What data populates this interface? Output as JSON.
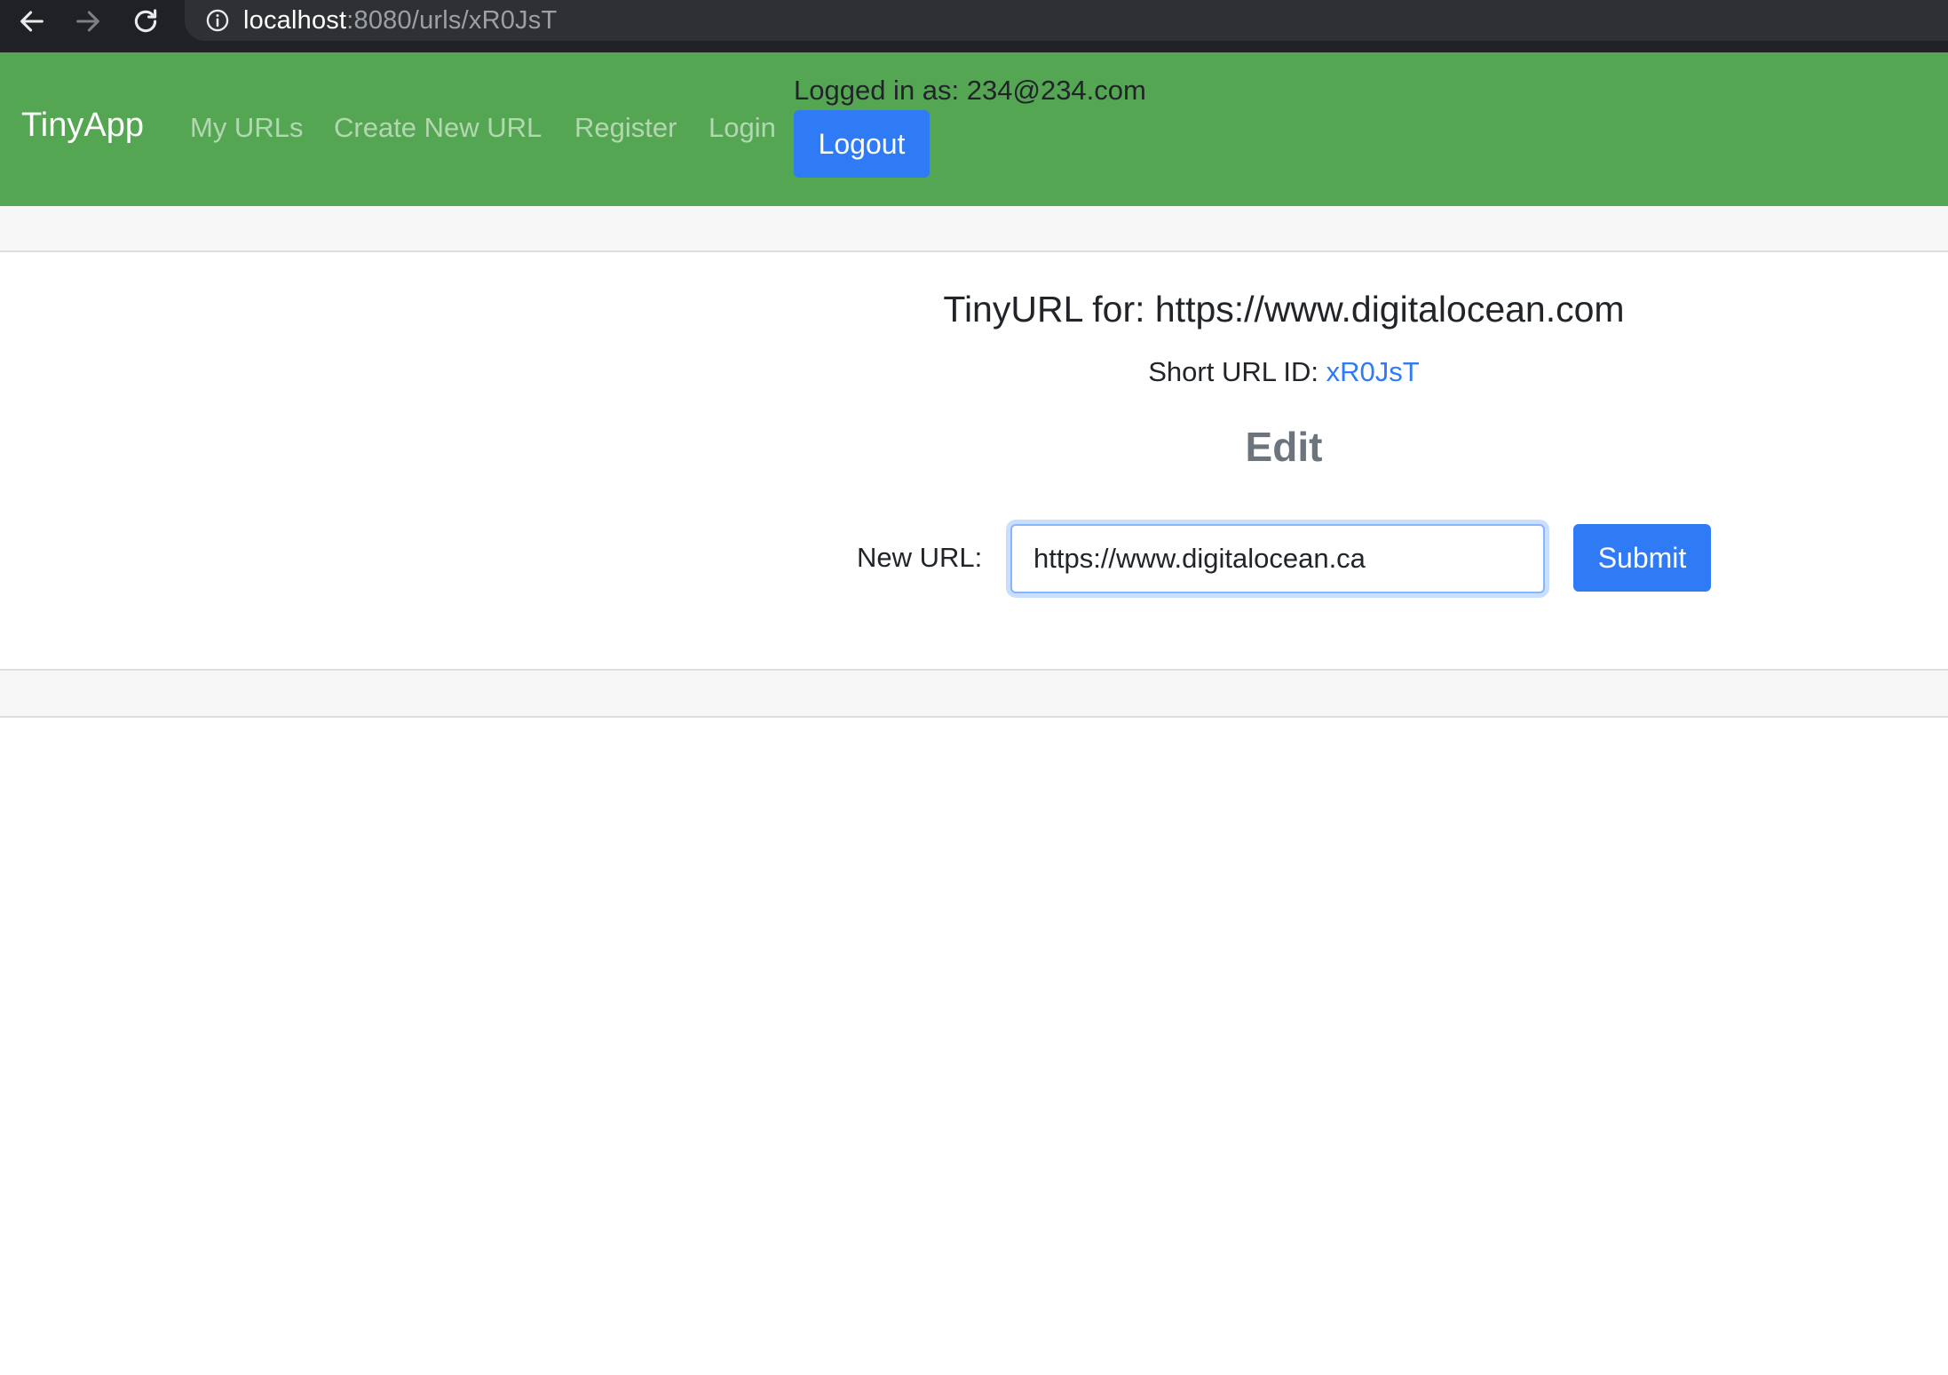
{
  "browser": {
    "url_host": "localhost",
    "url_path": ":8080/urls/xR0JsT",
    "icons": {
      "back": "arrow-left-icon",
      "forward": "arrow-right-icon",
      "reload": "reload-icon",
      "info": "info-circle-icon"
    }
  },
  "navbar": {
    "brand": "TinyApp",
    "links": [
      {
        "label": "My URLs"
      },
      {
        "label": "Create New URL"
      },
      {
        "label": "Register"
      },
      {
        "label": "Login"
      }
    ],
    "logged_in_text": "Logged in as: 234@234.com",
    "logout_label": "Logout",
    "background_color": "#55a653"
  },
  "main": {
    "title": "TinyURL for: https://www.digitalocean.com",
    "short_url_prefix": "Short URL ID: ",
    "short_url_id": "xR0JsT",
    "edit_heading": "Edit",
    "form": {
      "label": "New URL:",
      "input_value": "https://www.digitalocean.ca",
      "submit_label": "Submit"
    }
  },
  "colors": {
    "primary": "#2f7bf5",
    "muted": "#6c757d"
  }
}
